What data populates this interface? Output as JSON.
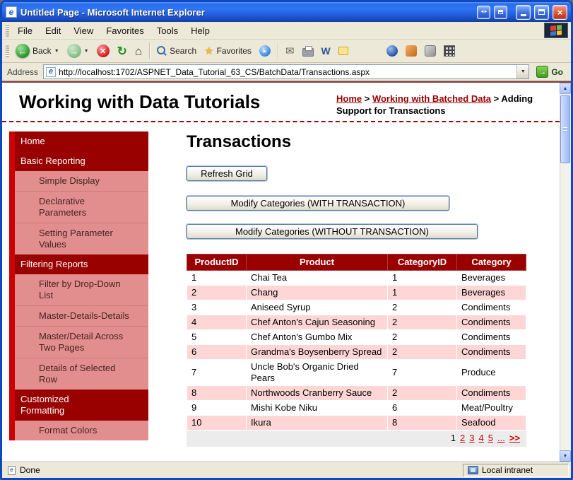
{
  "window": {
    "title": "Untitled Page - Microsoft Internet Explorer",
    "status": {
      "left": "Done",
      "zone_label": "Local intranet"
    }
  },
  "menu": {
    "items": [
      "File",
      "Edit",
      "View",
      "Favorites",
      "Tools",
      "Help"
    ]
  },
  "toolbar": {
    "back_label": "Back",
    "search_label": "Search",
    "favorites_label": "Favorites"
  },
  "address": {
    "label": "Address",
    "url": "http://localhost:1702/ASPNET_Data_Tutorial_63_CS/BatchData/Transactions.aspx",
    "go_label": "Go"
  },
  "page_header": {
    "title": "Working with Data Tutorials",
    "separator": ">",
    "breadcrumb": [
      {
        "label": "Home",
        "link": true
      },
      {
        "label": "Working with Batched Data",
        "link": true
      },
      {
        "label": "Adding Support for Transactions",
        "link": false
      }
    ]
  },
  "sidebar": {
    "items": [
      {
        "label": "Home",
        "level": 0
      },
      {
        "label": "Basic Reporting",
        "level": 0
      },
      {
        "label": "Simple Display",
        "level": 1
      },
      {
        "label": "Declarative Parameters",
        "level": 1
      },
      {
        "label": "Setting Parameter Values",
        "level": 1
      },
      {
        "label": "Filtering Reports",
        "level": 0
      },
      {
        "label": "Filter by Drop-Down List",
        "level": 1
      },
      {
        "label": "Master-Details-Details",
        "level": 1
      },
      {
        "label": "Master/Detail Across Two Pages",
        "level": 1
      },
      {
        "label": "Details of Selected Row",
        "level": 1
      },
      {
        "label": "Customized Formatting",
        "level": 0
      },
      {
        "label": "Format Colors",
        "level": 1
      }
    ]
  },
  "main": {
    "title": "Transactions",
    "refresh_button": "Refresh Grid",
    "with_transaction_button": "Modify Categories (WITH TRANSACTION)",
    "without_transaction_button": "Modify Categories (WITHOUT TRANSACTION)",
    "table": {
      "headers": [
        "ProductID",
        "Product",
        "CategoryID",
        "Category"
      ],
      "rows": [
        [
          "1",
          "Chai Tea",
          "1",
          "Beverages"
        ],
        [
          "2",
          "Chang",
          "1",
          "Beverages"
        ],
        [
          "3",
          "Aniseed Syrup",
          "2",
          "Condiments"
        ],
        [
          "4",
          "Chef Anton's Cajun Seasoning",
          "2",
          "Condiments"
        ],
        [
          "5",
          "Chef Anton's Gumbo Mix",
          "2",
          "Condiments"
        ],
        [
          "6",
          "Grandma's Boysenberry Spread",
          "2",
          "Condiments"
        ],
        [
          "7",
          "Uncle Bob's Organic Dried Pears",
          "7",
          "Produce"
        ],
        [
          "8",
          "Northwoods Cranberry Sauce",
          "2",
          "Condiments"
        ],
        [
          "9",
          "Mishi Kobe Niku",
          "6",
          "Meat/Poultry"
        ],
        [
          "10",
          "Ikura",
          "8",
          "Seafood"
        ]
      ],
      "pager": {
        "current": "1",
        "links": [
          "2",
          "3",
          "4",
          "5",
          "...",
          ">>"
        ]
      }
    }
  },
  "colors": {
    "accent_red": "#990000",
    "sidebar_stripe": "#cc0000",
    "sidebar_item_bg": "#e38e8e",
    "row_alt_pink": "#ffd6d6",
    "pager_bg": "#ececec",
    "link_red": "#cc0000"
  }
}
